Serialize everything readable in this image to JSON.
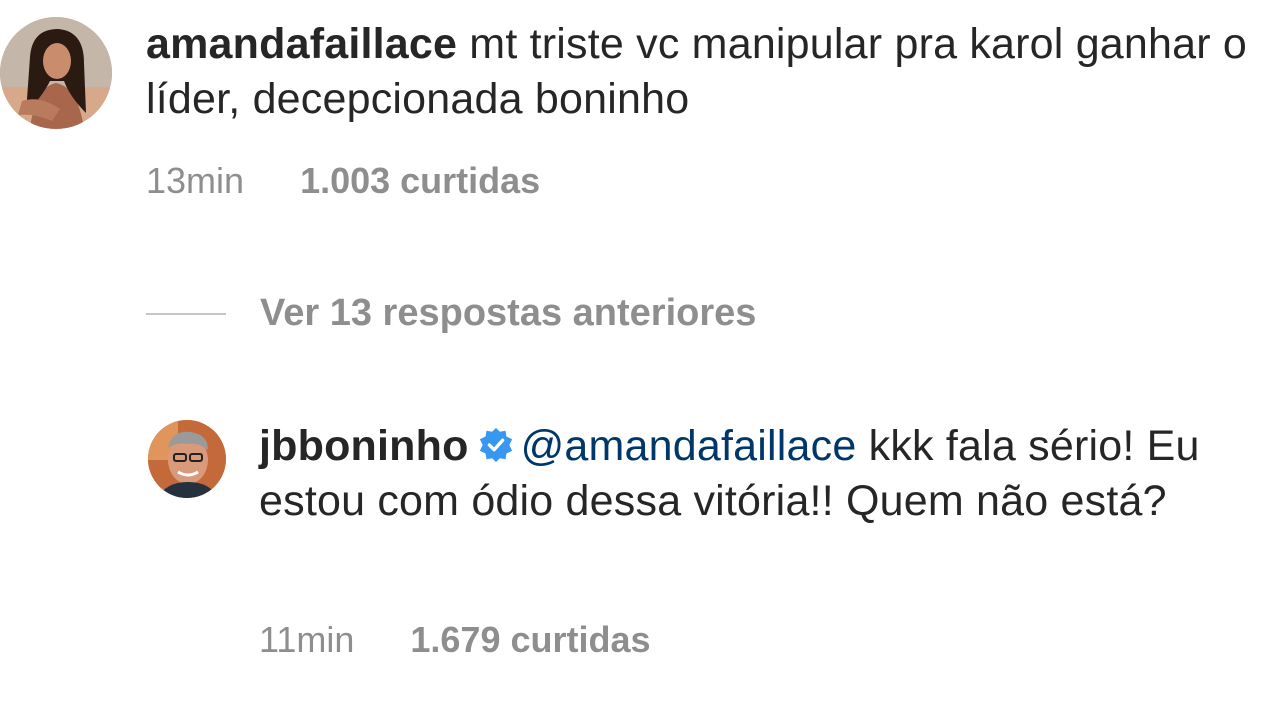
{
  "comments": [
    {
      "username": "amandafaillace",
      "text": "mt triste vc manipular pra karol ganhar o líder, decepcionada boninho",
      "time": "13min",
      "likes": "1.003 curtidas",
      "avatar": "profile-photo-amandafaillace"
    },
    {
      "username": "jbboninho",
      "verified": true,
      "mention": "@amandafaillace",
      "text": "kkk fala sério! Eu estou com ódio dessa vitória!! Quem não está?",
      "time": "11min",
      "likes": "1.679 curtidas",
      "avatar": "profile-photo-jbboninho"
    }
  ],
  "view_replies": {
    "label": "Ver 13 respostas anteriores"
  },
  "colors": {
    "text": "#262626",
    "secondary": "#8e8e8e",
    "mention": "#00376b",
    "verified": "#3897f0"
  },
  "icons": {
    "verified": "verified-badge-icon"
  }
}
